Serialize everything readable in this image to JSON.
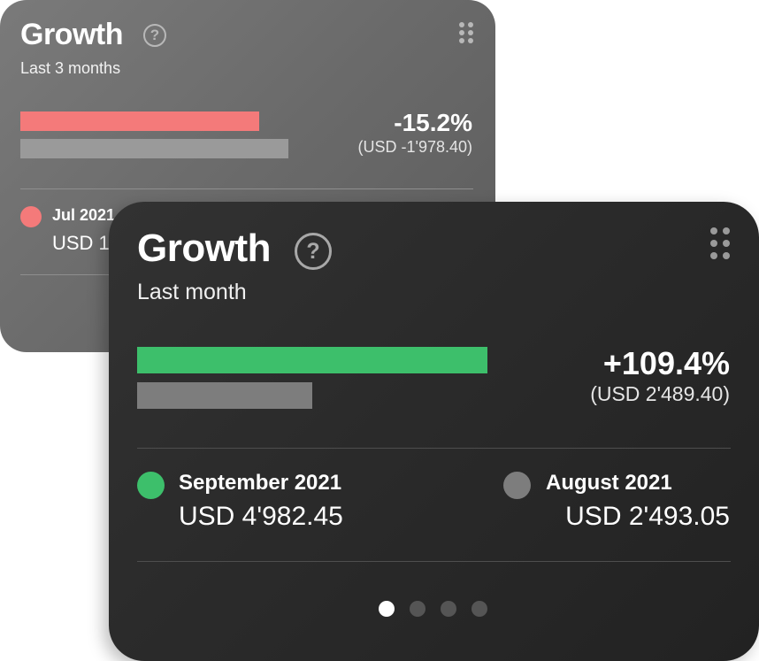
{
  "colors": {
    "decline": "#f47a7a",
    "growth": "#3dbf6b",
    "previous": "#7d7d7d",
    "card_back_bg": "#6a6a6a",
    "card_front_bg": "#2b2b2b"
  },
  "back_card": {
    "title": "Growth",
    "help_icon": "question-circle-icon",
    "help_symbol": "?",
    "drag_icon": "drag-handle-icon",
    "subtitle": "Last 3 months",
    "change_percent": "-15.2%",
    "change_amount": "(USD -1'978.40)",
    "current_period": {
      "label": "Jul 2021",
      "value": "USD 1"
    }
  },
  "front_card": {
    "title": "Growth",
    "help_icon": "question-circle-icon",
    "help_symbol": "?",
    "drag_icon": "drag-handle-icon",
    "subtitle": "Last month",
    "change_percent": "+109.4%",
    "change_amount": "(USD 2'489.40)",
    "current_period": {
      "label": "September 2021",
      "value": "USD 4'982.45"
    },
    "previous_period": {
      "label": "August 2021",
      "value": "USD 2'493.05"
    },
    "pager": {
      "count": 4,
      "active_index": 0
    }
  }
}
